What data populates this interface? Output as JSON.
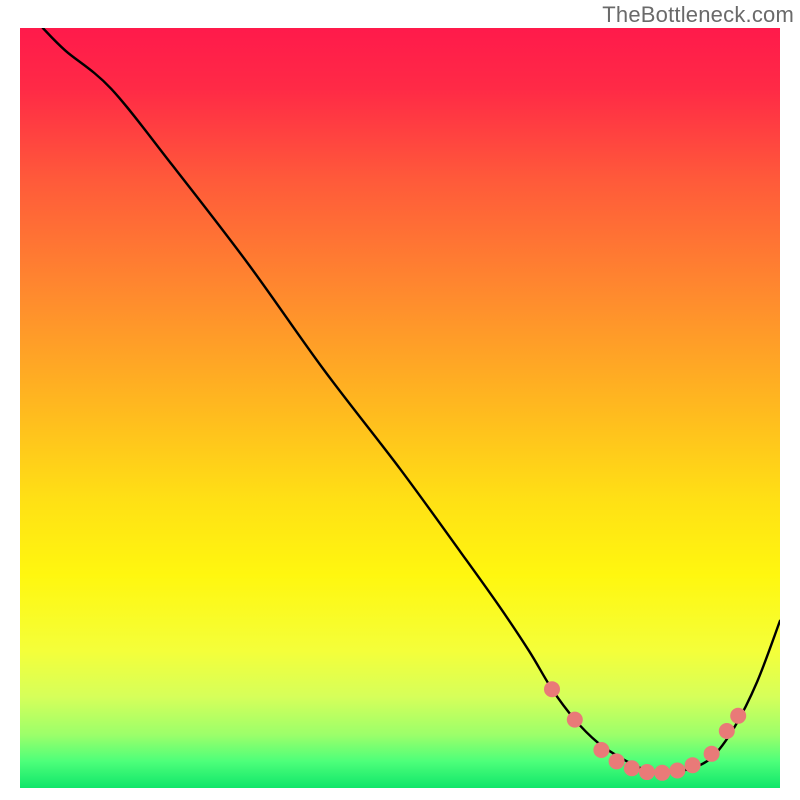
{
  "watermark": "TheBottleneck.com",
  "gradient": {
    "stops": [
      {
        "offset": 0.0,
        "color": "#ff1a4b"
      },
      {
        "offset": 0.08,
        "color": "#ff2a46"
      },
      {
        "offset": 0.2,
        "color": "#ff5a3a"
      },
      {
        "offset": 0.35,
        "color": "#ff8a2e"
      },
      {
        "offset": 0.5,
        "color": "#ffb91f"
      },
      {
        "offset": 0.62,
        "color": "#ffe015"
      },
      {
        "offset": 0.72,
        "color": "#fff70f"
      },
      {
        "offset": 0.82,
        "color": "#f4ff3a"
      },
      {
        "offset": 0.88,
        "color": "#d6ff5a"
      },
      {
        "offset": 0.93,
        "color": "#9cff6a"
      },
      {
        "offset": 0.965,
        "color": "#4dff7a"
      },
      {
        "offset": 1.0,
        "color": "#10e66a"
      }
    ]
  },
  "curve_style": {
    "stroke": "#000000",
    "width": 2.4
  },
  "marker_style": {
    "fill": "#e97a78",
    "radius": 8
  },
  "chart_data": {
    "type": "line",
    "title": "",
    "xlabel": "",
    "ylabel": "",
    "xlim": [
      0,
      100
    ],
    "ylim": [
      0,
      100
    ],
    "series": [
      {
        "name": "curve",
        "x": [
          3,
          6,
          12,
          20,
          30,
          40,
          50,
          58,
          63,
          67,
          70,
          73,
          76,
          79,
          82,
          85,
          88,
          91,
          94,
          97,
          100
        ],
        "y": [
          100,
          97,
          92,
          82,
          69,
          55,
          42,
          31,
          24,
          18,
          13,
          9,
          6,
          4,
          2.5,
          2,
          2.5,
          4,
          8,
          14,
          22
        ]
      }
    ],
    "markers": {
      "name": "highlighted-points",
      "x": [
        70,
        73,
        76.5,
        78.5,
        80.5,
        82.5,
        84.5,
        86.5,
        88.5,
        91,
        93,
        94.5
      ],
      "y": [
        13,
        9,
        5,
        3.5,
        2.6,
        2.1,
        2.0,
        2.3,
        3.0,
        4.5,
        7.5,
        9.5
      ]
    }
  }
}
